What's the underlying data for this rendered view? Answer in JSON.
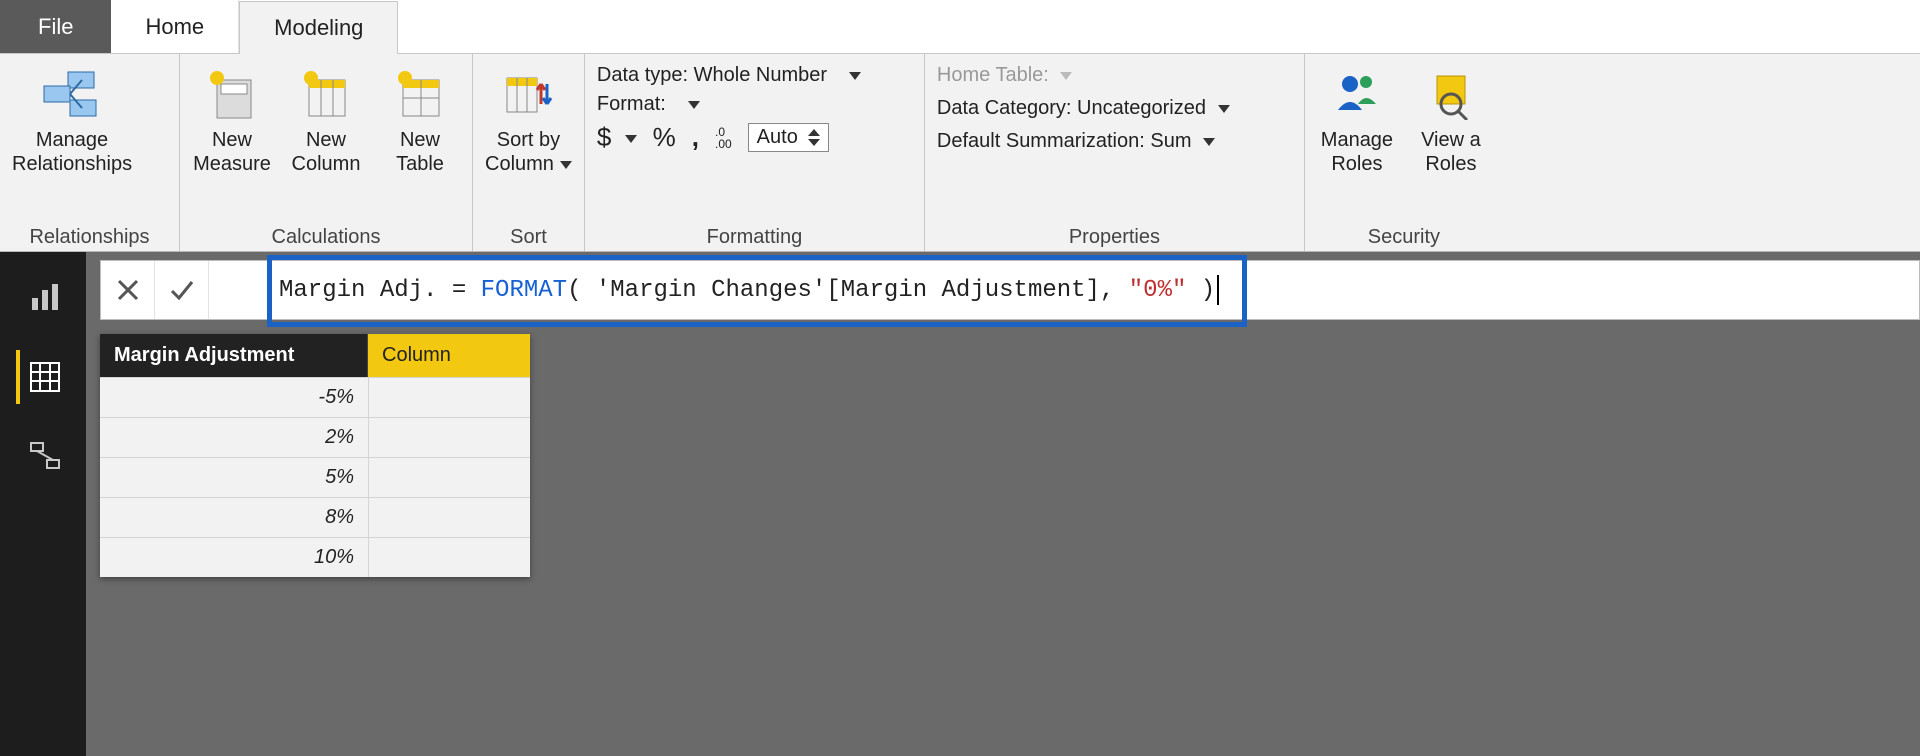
{
  "tabs": {
    "file": "File",
    "home": "Home",
    "modeling": "Modeling"
  },
  "ribbon": {
    "relationships": {
      "group": "Relationships",
      "manage": "Manage\nRelationships"
    },
    "calc": {
      "group": "Calculations",
      "newMeasure": "New\nMeasure",
      "newColumn": "New\nColumn",
      "newTable": "New\nTable"
    },
    "sort": {
      "group": "Sort",
      "sortBy": "Sort by\nColumn"
    },
    "fmt": {
      "group": "Formatting",
      "dataTypeLabel": "Data type:",
      "dataTypeValue": "Whole Number",
      "formatLabel": "Format:",
      "currency": "$",
      "percent": "%",
      "comma": ",",
      "decimals": ".0\n.00",
      "auto": "Auto"
    },
    "props": {
      "group": "Properties",
      "homeTable": "Home Table:",
      "dataCatLabel": "Data Category:",
      "dataCatValue": "Uncategorized",
      "defSumLabel": "Default Summarization:",
      "defSumValue": "Sum"
    },
    "security": {
      "group": "Security",
      "manageRoles": "Manage\nRoles",
      "viewAs": "View a\nRoles"
    }
  },
  "viewrail": {
    "report": "report-icon",
    "data": "data-icon",
    "model": "model-icon"
  },
  "formula": {
    "prefix": "Margin Adj. = ",
    "fn": "FORMAT",
    "open": "(",
    "arg": " 'Margin Changes'[Margin Adjustment], ",
    "fmt": "\"0%\"",
    "close": " )"
  },
  "table": {
    "headers": {
      "h1": "Margin Adjustment",
      "h2": "Column"
    },
    "rows": [
      "-5%",
      "2%",
      "5%",
      "8%",
      "10%"
    ]
  }
}
